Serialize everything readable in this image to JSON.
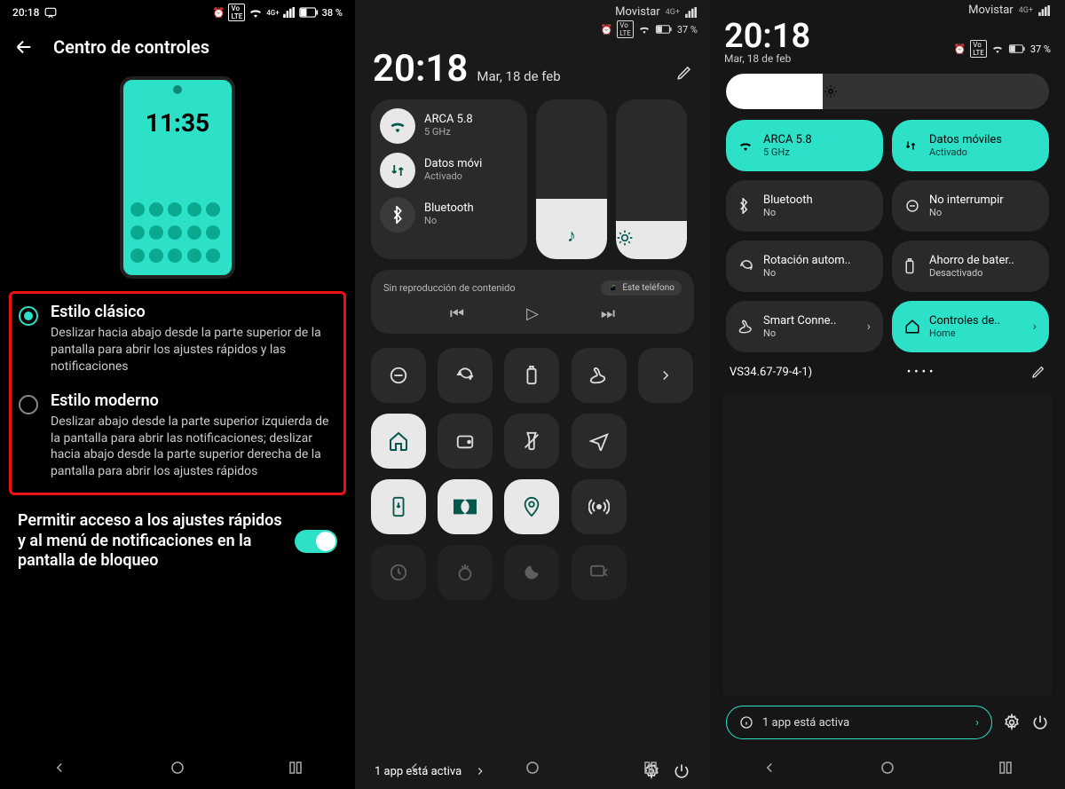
{
  "panel1": {
    "status": {
      "time": "20:18",
      "battery": "38 %"
    },
    "header": "Centro de controles",
    "mock_time": "11:35",
    "style_classic": {
      "title": "Estilo clásico",
      "desc": "Deslizar hacia abajo desde la parte superior de la pantalla para abrir los ajustes rápidos y las notificaciones"
    },
    "style_modern": {
      "title": "Estilo moderno",
      "desc": "Deslizar abajo desde la parte superior izquierda de la pantalla para abrir las notificaciones; deslizar hacia abajo desde la parte superior derecha de la pantalla para abrir los ajustes rápidos"
    },
    "toggle_label": "Permitir acceso a los ajustes rápidos y al menú de notificaciones en la pantalla de bloqueo"
  },
  "panel2": {
    "carrier": "Movistar",
    "net_badge": "4G+",
    "battery": "37 %",
    "time": "20:18",
    "date": "Mar, 18 de feb",
    "wifi": {
      "name": "ARCA 5.8",
      "sub": "5 GHz"
    },
    "data": {
      "name": "Datos móvi",
      "sub": "Activado"
    },
    "bt": {
      "name": "Bluetooth",
      "sub": "No"
    },
    "media_empty": "Sin reproducción de contenido",
    "media_chip": "Este teléfono",
    "footer": "1 app está activa"
  },
  "panel3": {
    "carrier": "Movistar",
    "net_badge": "4G+",
    "battery": "37 %",
    "time": "20:18",
    "date": "Mar, 18 de feb",
    "tiles": {
      "wifi": {
        "name": "ARCA 5.8",
        "sub": "5 GHz"
      },
      "data": {
        "name": "Datos móviles",
        "sub": "Activado"
      },
      "bt": {
        "name": "Bluetooth",
        "sub": "No"
      },
      "dnd": {
        "name": "No interrumpir",
        "sub": "No"
      },
      "rot": {
        "name": "Rotación autom..",
        "sub": "No"
      },
      "bat": {
        "name": "Ahorro de bater..",
        "sub": "Desactivado"
      },
      "smart": {
        "name": "Smart Conne..",
        "sub": "No"
      },
      "home": {
        "name": "Controles de..",
        "sub": "Home"
      }
    },
    "ssid": "VS34.67-79-4-1)",
    "dots": "••••",
    "footer": "1 app está activa"
  }
}
